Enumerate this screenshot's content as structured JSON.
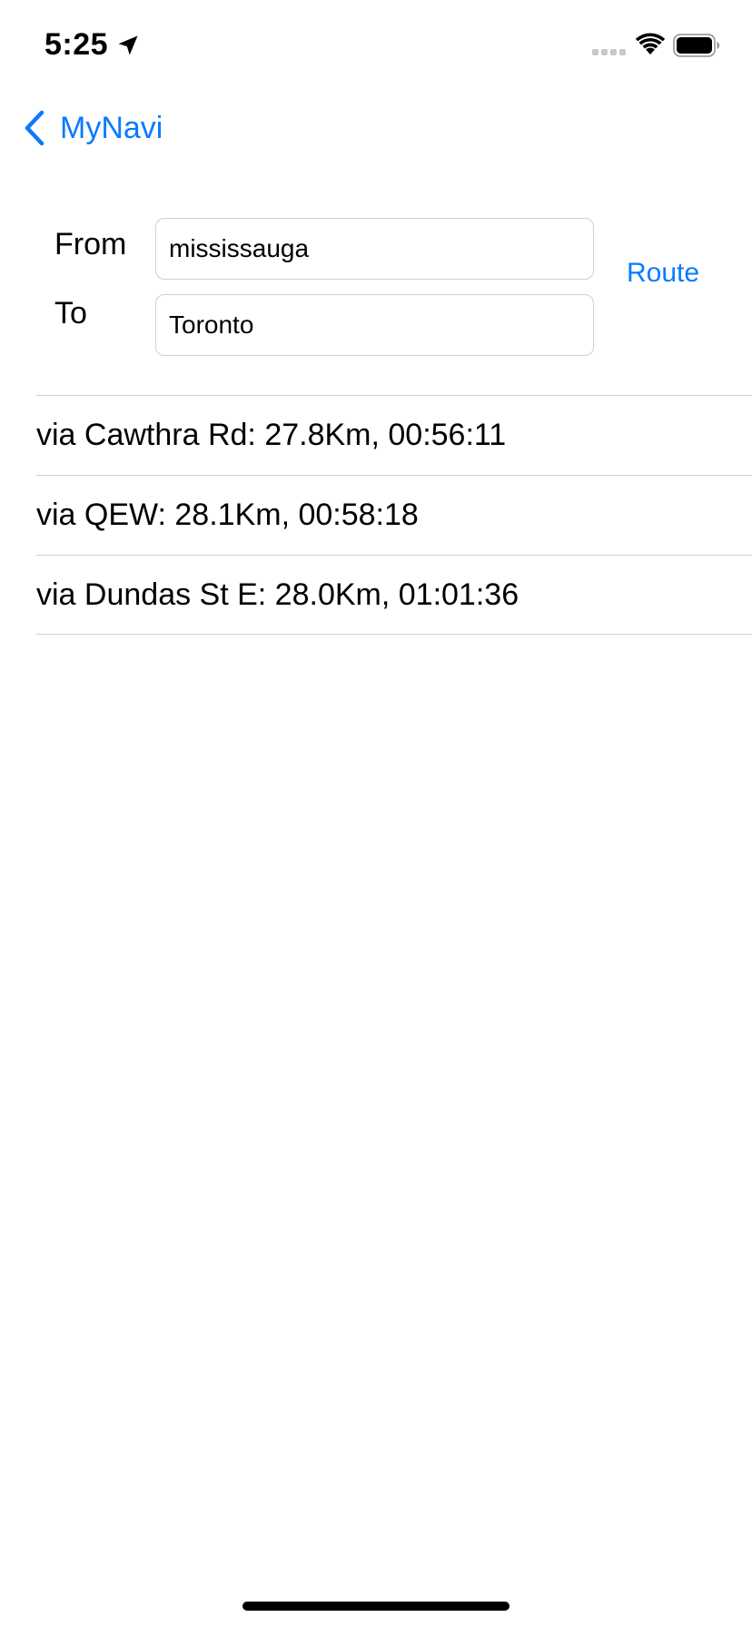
{
  "status_bar": {
    "time": "5:25",
    "icons": [
      "location-arrow-icon",
      "cellular-signal-icon",
      "wifi-icon",
      "battery-icon"
    ]
  },
  "nav": {
    "back_label": "MyNavi",
    "back_icon": "chevron-left-icon"
  },
  "form": {
    "from_label": "From",
    "from_value": "mississauga",
    "to_label": "To",
    "to_value": "Toronto",
    "route_button": "Route"
  },
  "routes": [
    "via Cawthra Rd: 27.8Km, 00:56:11",
    "via QEW: 28.1Km, 00:58:18",
    "via Dundas St E: 28.0Km, 01:01:36"
  ],
  "colors": {
    "accent": "#0a7aff",
    "separator": "#d1d1d6",
    "field_border": "#cfcfd4"
  }
}
